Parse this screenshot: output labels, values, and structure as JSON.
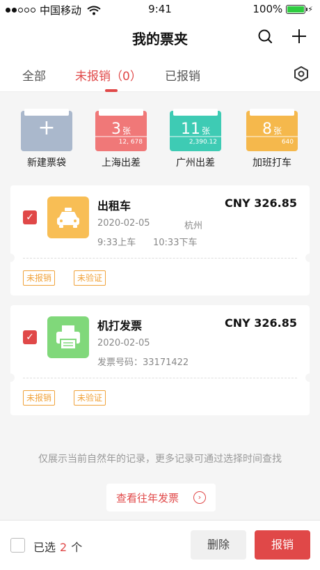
{
  "status_bar": {
    "carrier": "中国移动",
    "time": "9:41",
    "battery": "100%",
    "battery_level": 1.0
  },
  "header": {
    "title": "我的票夹"
  },
  "tabs": [
    {
      "label": "全部",
      "active": false
    },
    {
      "label": "未报销（0）",
      "active": true
    },
    {
      "label": "已报销",
      "active": false
    }
  ],
  "folders": [
    {
      "label": "新建票袋",
      "count": "",
      "unit": "",
      "sub": "",
      "color": "#aab8cc"
    },
    {
      "label": "上海出差",
      "count": "3",
      "unit": "张",
      "sub": "12, 678",
      "color": "#f07878"
    },
    {
      "label": "广州出差",
      "count": "11",
      "unit": "张",
      "sub": "2,390.12",
      "color": "#3ecbb4"
    },
    {
      "label": "加班打车",
      "count": "8",
      "unit": "张",
      "sub": "640",
      "color": "#f5b84c"
    }
  ],
  "tickets": [
    {
      "title": "出租车",
      "amount": "CNY 326.85",
      "date": "2020-02-05",
      "city": "杭州",
      "time_on": "9:33上车",
      "time_off": "10:33下车",
      "tags": [
        "未报销",
        "未验证"
      ],
      "icon": "taxi-icon",
      "icon_color": "#f8be55",
      "checked": true
    },
    {
      "title": "机打发票",
      "amount": "CNY 326.85",
      "date": "2020-02-05",
      "invoice_no": "发票号码：33171422",
      "tags": [
        "未报销",
        "未验证"
      ],
      "icon": "printer-icon",
      "icon_color": "#80d87a",
      "checked": true
    }
  ],
  "note": "仅展示当前自然年的记录，更多记录可通过选择时间查找",
  "history_button": "查看往年发票",
  "bottom": {
    "selected_prefix": "已选",
    "selected_count": "2",
    "selected_suffix": "个",
    "delete_label": "删除",
    "submit_label": "报销"
  },
  "colors": {
    "accent": "#e04848",
    "tag": "#f0a23a"
  }
}
